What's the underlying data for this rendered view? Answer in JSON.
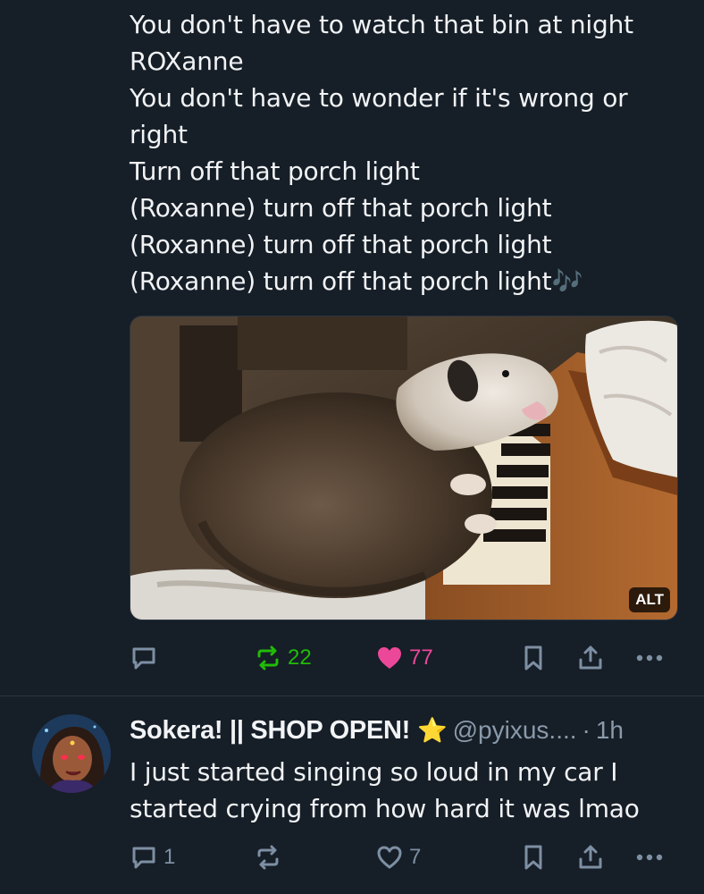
{
  "post": {
    "lines": [
      "You don't have to watch that bin at night",
      "ROXanne",
      "You don't have to wonder if it's wrong or",
      "right",
      "Turn off that porch light",
      "(Roxanne) turn off that porch light",
      "(Roxanne) turn off that porch light",
      "(Roxanne) turn off that porch light🎶"
    ],
    "image_alt_badge": "ALT",
    "repost_count": "22",
    "like_count": "77"
  },
  "reply": {
    "display_name": "Sokera! || SHOP OPEN!",
    "star": "⭐",
    "handle": "@pyixus....",
    "separator": "·",
    "time": "1h",
    "lines": [
      "I just started singing so loud in my car I",
      "started crying from how hard it was lmao"
    ],
    "reply_count": "1",
    "like_count": "7"
  },
  "icons": {
    "reply": "speech-bubble-icon",
    "repost": "repost-arrows-icon",
    "like": "heart-icon",
    "bookmark": "bookmark-icon",
    "share": "share-upload-icon",
    "more": "ellipsis-icon"
  },
  "colors": {
    "background": "#161e27",
    "text": "#f1f3f5",
    "muted": "#8a9aaa",
    "icon": "#7d8fa3",
    "repost_active": "#20bc07",
    "like_active": "#ec4899"
  }
}
